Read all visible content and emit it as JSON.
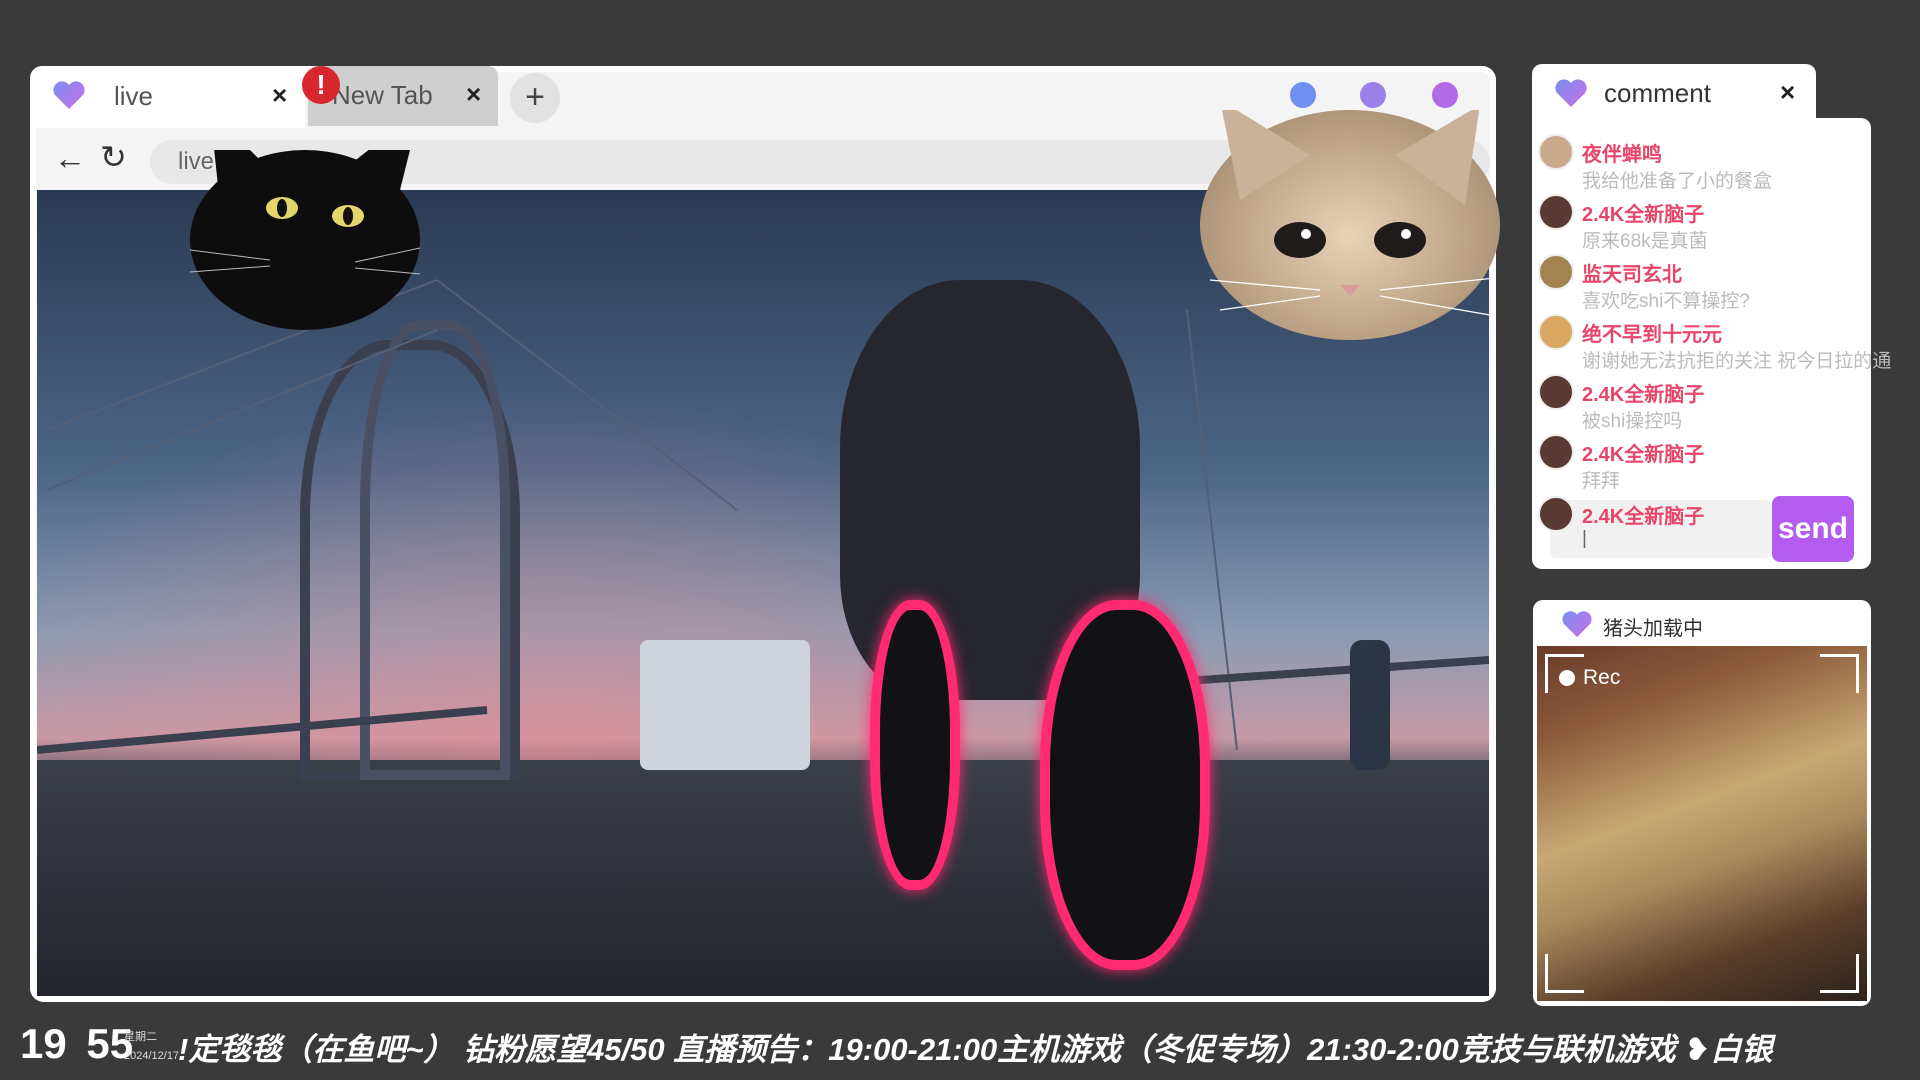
{
  "tabs": [
    {
      "label": "live",
      "close": "×"
    },
    {
      "label": "New Tab",
      "close": "×"
    }
  ],
  "new_tab_button": "+",
  "alert_badge": "!",
  "address": {
    "text": "live"
  },
  "nav": {
    "back": "←",
    "reload": "↻"
  },
  "comment_panel": {
    "title": "comment",
    "close": "×",
    "messages": [
      {
        "user": "夜伴蝉鸣",
        "text": "我给他准备了小的餐盒"
      },
      {
        "user": "2.4K全新脑子",
        "text": "原来68k是真菌"
      },
      {
        "user": "监天司玄北",
        "text": "喜欢吃shi不算操控?"
      },
      {
        "user": "绝不早到十元元",
        "text": "谢谢她无法抗拒的关注 祝今日拉的通"
      },
      {
        "user": "2.4K全新脑子",
        "text": "被shi操控吗"
      },
      {
        "user": "2.4K全新脑子",
        "text": "拜拜"
      },
      {
        "user": "2.4K全新脑子",
        "text": ""
      }
    ],
    "input_value": "|",
    "send_label": "send"
  },
  "cam_panel": {
    "title": "猪头加载中",
    "rec_label": "Rec"
  },
  "ticker": {
    "time_hour": "19",
    "time_min": "55",
    "weekday": "星期二",
    "date": "2024/12/17",
    "text": "!定毯毯（在鱼吧~）  钻粉愿望45/50   直播预告：19:00-21:00主机游戏（冬促专场）21:30-2:00竞技与联机游戏  ❥白银"
  },
  "colors": {
    "accent_purple": "#b55cf0",
    "username_pink": "#e8456a",
    "dot_blue": "#6f8ff0",
    "dot_violet": "#9a80e8",
    "dot_purple": "#b26ae6",
    "bike_neon": "#ff2a72"
  },
  "icons": [
    "heart-icon",
    "close-icon",
    "plus-icon",
    "alert-icon",
    "back-arrow-icon",
    "reload-icon",
    "rec-dot-icon"
  ]
}
